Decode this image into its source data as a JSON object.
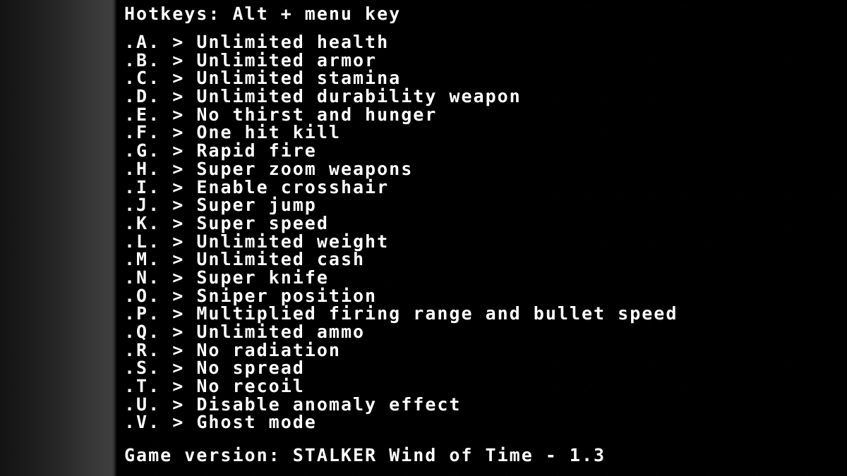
{
  "overlay": {
    "title": "Hotkeys: Alt + menu key",
    "version_line": "Game version: STALKER Wind of Time - 1.3",
    "arrow_glyph": ">",
    "key_prefix": ".",
    "key_suffix": ".",
    "colors": {
      "text": "#ffffff",
      "panel_background": "#000000",
      "gradient_dark": "#131313",
      "gradient_light": "#3e3e3e"
    }
  },
  "hotkeys": [
    {
      "key": ".A.",
      "arrow": ">",
      "label": "Unlimited health"
    },
    {
      "key": ".B.",
      "arrow": ">",
      "label": "Unlimited armor"
    },
    {
      "key": ".C.",
      "arrow": ">",
      "label": "Unlimited stamina"
    },
    {
      "key": ".D.",
      "arrow": ">",
      "label": "Unlimited durability weapon"
    },
    {
      "key": ".E.",
      "arrow": ">",
      "label": "No thirst and hunger"
    },
    {
      "key": ".F.",
      "arrow": ">",
      "label": "One hit kill"
    },
    {
      "key": ".G.",
      "arrow": ">",
      "label": "Rapid fire"
    },
    {
      "key": ".H.",
      "arrow": ">",
      "label": "Super zoom weapons"
    },
    {
      "key": ".I.",
      "arrow": ">",
      "label": "Enable crosshair"
    },
    {
      "key": ".J.",
      "arrow": ">",
      "label": "Super jump"
    },
    {
      "key": ".K.",
      "arrow": ">",
      "label": "Super speed"
    },
    {
      "key": ".L.",
      "arrow": ">",
      "label": "Unlimited weight"
    },
    {
      "key": ".M.",
      "arrow": ">",
      "label": "Unlimited cash"
    },
    {
      "key": ".N.",
      "arrow": ">",
      "label": "Super knife"
    },
    {
      "key": ".O.",
      "arrow": ">",
      "label": "Sniper position"
    },
    {
      "key": ".P.",
      "arrow": ">",
      "label": "Multiplied firing range and bullet speed"
    },
    {
      "key": ".Q.",
      "arrow": ">",
      "label": "Unlimited ammo"
    },
    {
      "key": ".R.",
      "arrow": ">",
      "label": "No radiation"
    },
    {
      "key": ".S.",
      "arrow": ">",
      "label": "No spread"
    },
    {
      "key": ".T.",
      "arrow": ">",
      "label": "No recoil"
    },
    {
      "key": ".U.",
      "arrow": ">",
      "label": "Disable anomaly effect"
    },
    {
      "key": ".V.",
      "arrow": ">",
      "label": "Ghost mode"
    }
  ]
}
